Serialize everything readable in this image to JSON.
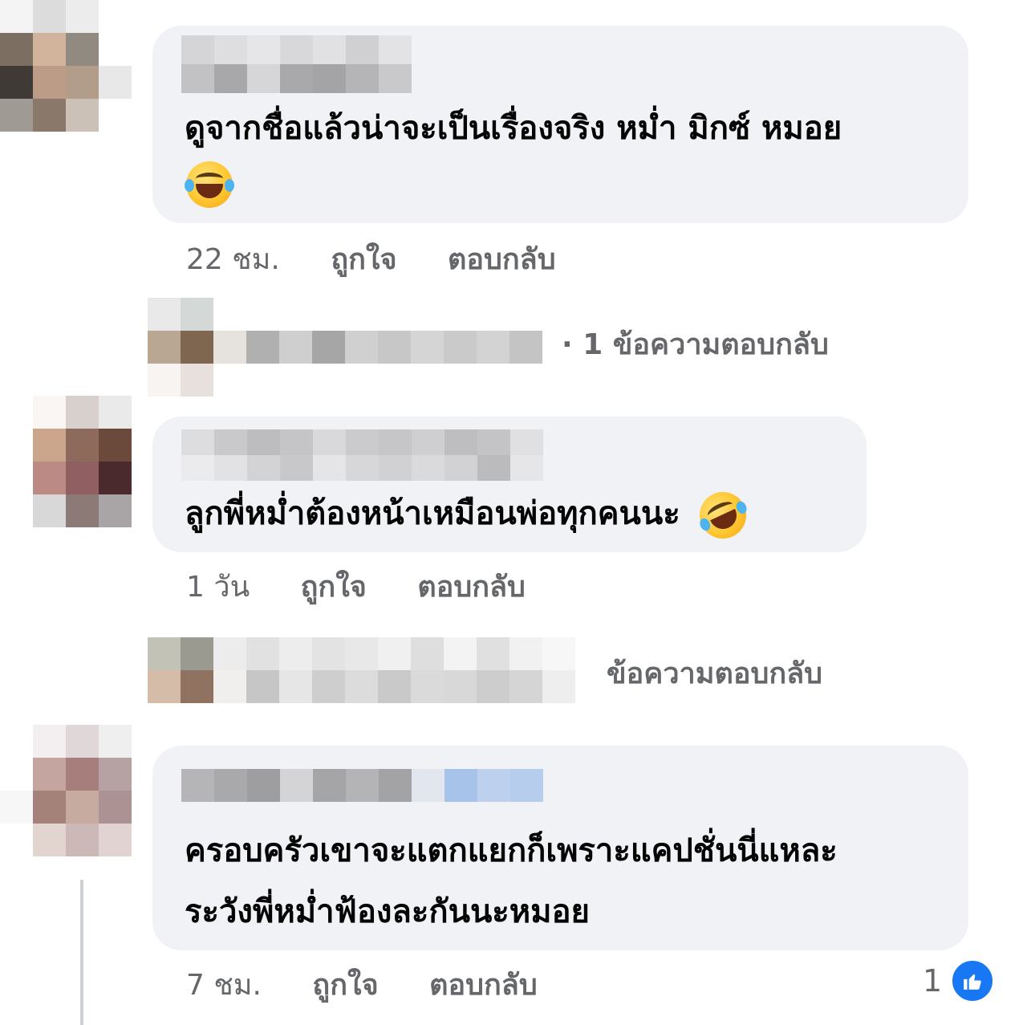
{
  "comments": [
    {
      "text_lines": [
        "ดูจากชื่อแล้วน่าจะเป็นเรื่องจริง หม่ำ มิกซ์ หมอย"
      ],
      "emoji": "face-with-tears-of-joy",
      "time": "22 ชม.",
      "like_label": "ถูกใจ",
      "reply_label": "ตอบกลับ",
      "replies_link": "· 1 ข้อความตอบกลับ"
    },
    {
      "text_lines": [
        "ลูกพี่หม่ำต้องหน้าเหมือนพ่อทุกคนนะ"
      ],
      "emoji": "rolling-on-the-floor-laughing",
      "time": "1 วัน",
      "like_label": "ถูกใจ",
      "reply_label": "ตอบกลับ",
      "replies_link": "ข้อความตอบกลับ"
    },
    {
      "text_lines": [
        "ครอบครัวเขาจะแตกแยกก็เพราะแคปชั่นนี่แหละ",
        "ระวังพี่หม่ำฟ้องละกันนะหมอย"
      ],
      "time": "7 ชม.",
      "like_label": "ถูกใจ",
      "reply_label": "ตอบกลับ",
      "reaction_count": "1",
      "reaction_icon": "like-thumbs-up-icon"
    }
  ],
  "colors": {
    "bubble": "#f0f2f5",
    "meta_text": "#65676b",
    "text": "#050505",
    "like_blue": "#1877f2"
  }
}
